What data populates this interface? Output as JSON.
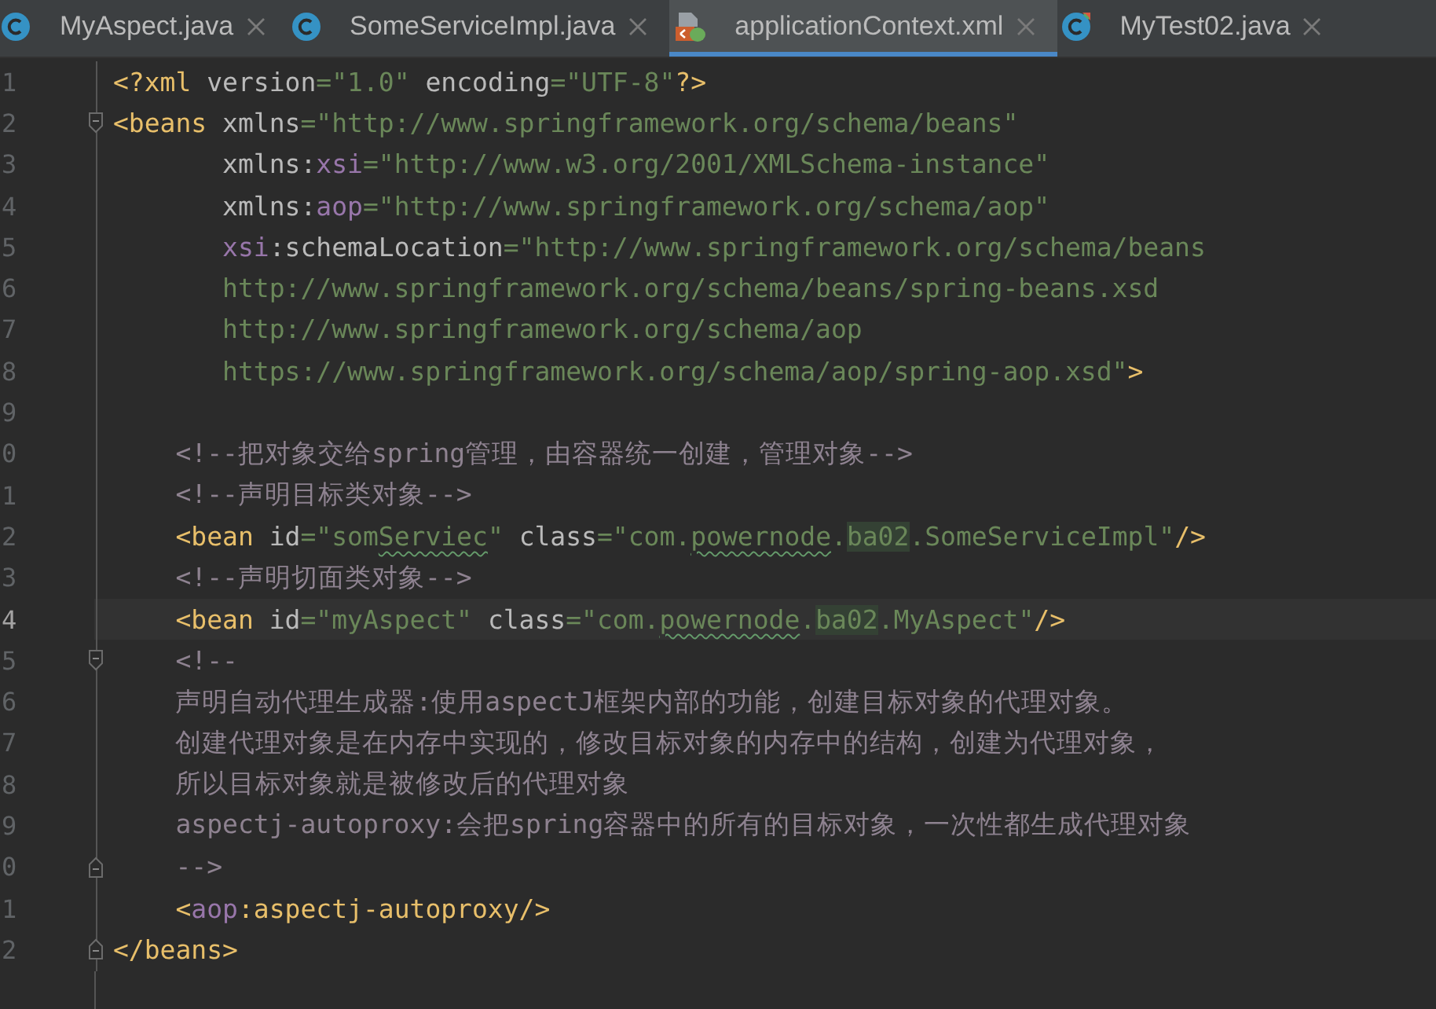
{
  "tabs": [
    {
      "label": "MyAspect.java",
      "kind": "class",
      "selected": false
    },
    {
      "label": "SomeServiceImpl.java",
      "kind": "class",
      "selected": false
    },
    {
      "label": "applicationContext.xml",
      "kind": "xml",
      "selected": true
    },
    {
      "label": "MyTest02.java",
      "kind": "test",
      "selected": false
    }
  ],
  "editor": {
    "lines": [
      {
        "number": "1",
        "current": false,
        "kind": "plain",
        "tokens": [
          {
            "kind": "tag",
            "text": "<?xml "
          },
          {
            "kind": "attr",
            "text": "version"
          },
          {
            "kind": "value",
            "text": "=\"1.0\" "
          },
          {
            "kind": "attr",
            "text": "encoding"
          },
          {
            "kind": "value",
            "text": "=\"UTF-8\""
          },
          {
            "kind": "tag",
            "text": "?>"
          }
        ]
      },
      {
        "number": "2",
        "current": false,
        "kind": "open",
        "tokens": [
          {
            "kind": "tag",
            "text": "<beans "
          },
          {
            "kind": "attr",
            "text": "xmlns"
          },
          {
            "kind": "value",
            "text": "=\"http://www.springframework.org/schema/beans\""
          }
        ]
      },
      {
        "number": "3",
        "current": false,
        "kind": "plain",
        "tokens": [
          {
            "kind": "attr",
            "text": "       xmlns:"
          },
          {
            "kind": "ns",
            "text": "xsi"
          },
          {
            "kind": "value",
            "text": "=\"http://www.w3.org/2001/XMLSchema-instance\""
          }
        ]
      },
      {
        "number": "4",
        "current": false,
        "kind": "plain",
        "tokens": [
          {
            "kind": "attr",
            "text": "       xmlns:"
          },
          {
            "kind": "ns",
            "text": "aop"
          },
          {
            "kind": "value",
            "text": "=\"http://www.springframework.org/schema/aop\""
          }
        ]
      },
      {
        "number": "5",
        "current": false,
        "kind": "plain",
        "tokens": [
          {
            "kind": "ns",
            "text": "       xsi"
          },
          {
            "kind": "attr",
            "text": ":schemaLocation"
          },
          {
            "kind": "value",
            "text": "=\"http://www.springframework.org/schema/beans"
          }
        ]
      },
      {
        "number": "6",
        "current": false,
        "kind": "plain",
        "tokens": [
          {
            "kind": "value",
            "text": "       http://www.springframework.org/schema/beans/spring-beans.xsd"
          }
        ]
      },
      {
        "number": "7",
        "current": false,
        "kind": "plain",
        "tokens": [
          {
            "kind": "value",
            "text": "       http://www.springframework.org/schema/aop"
          }
        ]
      },
      {
        "number": "8",
        "current": false,
        "kind": "plain",
        "tokens": [
          {
            "kind": "value",
            "text": "       https://www.springframework.org/schema/aop/spring-aop.xsd\""
          },
          {
            "kind": "tag",
            "text": ">"
          }
        ]
      },
      {
        "number": "9",
        "current": false,
        "kind": "plain"
      },
      {
        "number": "0",
        "current": false,
        "kind": "plain",
        "tokens": [
          {
            "kind": "comment",
            "text": "    <!--把对象交给spring管理，由容器统一创建，管理对象-->"
          }
        ]
      },
      {
        "number": "1",
        "current": false,
        "kind": "plain",
        "tokens": [
          {
            "kind": "comment",
            "text": "    <!--声明目标类对象-->"
          }
        ]
      },
      {
        "number": "2",
        "current": false,
        "kind": "plain",
        "tokens": [
          {
            "kind": "tag",
            "text": "    <bean "
          },
          {
            "kind": "attr",
            "text": "id"
          },
          {
            "kind": "value",
            "text": "=\"som"
          },
          {
            "kind": "typo",
            "text": "Serviec"
          },
          {
            "kind": "value",
            "text": "\" "
          },
          {
            "kind": "attr",
            "text": "class"
          },
          {
            "kind": "value",
            "text": "=\"com."
          },
          {
            "kind": "typo",
            "text": "powernode"
          },
          {
            "kind": "value",
            "text": "."
          },
          {
            "kind": "highlight",
            "text": "ba02"
          },
          {
            "kind": "value",
            "text": ".SomeServiceImpl\""
          },
          {
            "kind": "tag",
            "text": "/>"
          }
        ]
      },
      {
        "number": "3",
        "current": false,
        "kind": "plain",
        "tokens": [
          {
            "kind": "comment",
            "text": "    <!--声明切面类对象-->"
          }
        ]
      },
      {
        "number": "4",
        "current": true,
        "kind": "plain",
        "tokens": [
          {
            "kind": "tag",
            "text": "    <bean "
          },
          {
            "kind": "attr",
            "text": "id"
          },
          {
            "kind": "value",
            "text": "=\"myAspect\" "
          },
          {
            "kind": "attr",
            "text": "class"
          },
          {
            "kind": "value",
            "text": "=\"com."
          },
          {
            "kind": "typo",
            "text": "powernode"
          },
          {
            "kind": "value",
            "text": "."
          },
          {
            "kind": "highlight",
            "text": "ba02"
          },
          {
            "kind": "value",
            "text": ".MyAspect\""
          },
          {
            "kind": "tag",
            "text": "/>"
          }
        ]
      },
      {
        "number": "5",
        "current": false,
        "kind": "open",
        "tokens": [
          {
            "kind": "comment",
            "text": "    <!--"
          }
        ]
      },
      {
        "number": "6",
        "current": false,
        "kind": "plain",
        "tokens": [
          {
            "kind": "comment",
            "text": "    声明自动代理生成器:使用aspectJ框架内部的功能，创建目标对象的代理对象。"
          }
        ]
      },
      {
        "number": "7",
        "current": false,
        "kind": "plain",
        "tokens": [
          {
            "kind": "comment",
            "text": "    创建代理对象是在内存中实现的，修改目标对象的内存中的结构，创建为代理对象，"
          }
        ]
      },
      {
        "number": "8",
        "current": false,
        "kind": "plain",
        "tokens": [
          {
            "kind": "comment",
            "text": "    所以目标对象就是被修改后的代理对象"
          }
        ]
      },
      {
        "number": "9",
        "current": false,
        "kind": "plain",
        "tokens": [
          {
            "kind": "comment",
            "text": "    aspectj-autoproxy:会把spring容器中的所有的目标对象，一次性都生成代理对象"
          }
        ]
      },
      {
        "number": "0",
        "current": false,
        "kind": "close",
        "tokens": [
          {
            "kind": "comment",
            "text": "    -->"
          }
        ]
      },
      {
        "number": "1",
        "current": false,
        "kind": "plain",
        "tokens": [
          {
            "kind": "tag",
            "text": "    <"
          },
          {
            "kind": "ns",
            "text": "aop"
          },
          {
            "kind": "tag",
            "text": ":aspectj-autoproxy/>"
          }
        ]
      },
      {
        "number": "2",
        "current": false,
        "kind": "close",
        "tokens": [
          {
            "kind": "tag",
            "text": "</beans>"
          }
        ]
      }
    ]
  }
}
